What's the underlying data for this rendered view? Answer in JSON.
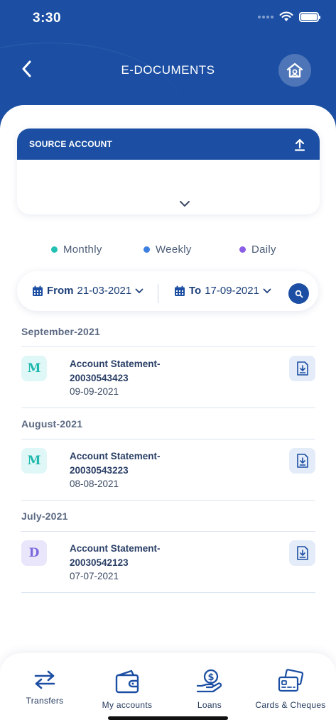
{
  "status_bar": {
    "time": "3:30"
  },
  "header": {
    "title": "E-DOCUMENTS"
  },
  "source_account": {
    "title": "SOURCE ACCOUNT"
  },
  "filters": {
    "frequencies": [
      {
        "label": "Monthly",
        "color": "#22c1b3"
      },
      {
        "label": "Weekly",
        "color": "#3d7fe0"
      },
      {
        "label": "Daily",
        "color": "#8a5ee6"
      }
    ],
    "from_label": "From",
    "from_date": "21-03-2021",
    "to_label": "To",
    "to_date": "17-09-2021"
  },
  "documents": [
    {
      "month": "September-2021",
      "badge": "M",
      "title_line1": "Account Statement-",
      "title_line2": "20030543423",
      "date": "09-09-2021"
    },
    {
      "month": "August-2021",
      "badge": "M",
      "title_line1": "Account Statement-",
      "title_line2": "20030543223",
      "date": "08-08-2021"
    },
    {
      "month": "July-2021",
      "badge": "D",
      "title_line1": "Account Statement-",
      "title_line2": "20030542123",
      "date": "07-07-2021"
    }
  ],
  "tabbar": {
    "items": [
      {
        "label": "Transfers",
        "icon": "transfer-arrows-icon"
      },
      {
        "label": "My accounts",
        "icon": "wallet-icon"
      },
      {
        "label": "Loans",
        "icon": "loan-hand-coin-icon"
      },
      {
        "label": "Cards & Cheques",
        "icon": "cards-icon"
      }
    ]
  },
  "colors": {
    "primary": "#1c4fa3",
    "text_dark": "#2a3f66"
  }
}
